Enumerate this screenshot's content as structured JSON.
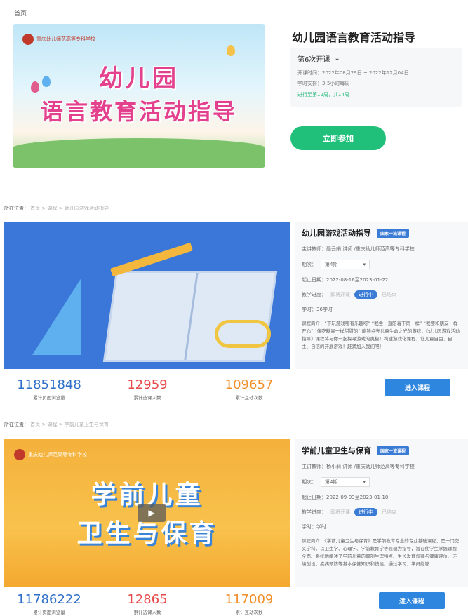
{
  "breadcrumb_top": "首页",
  "hero": {
    "banner_logo": "重庆幼儿师范高等专科学校",
    "banner_title_line1": "幼儿园",
    "banner_title_line2": "语言教育活动指导",
    "title": "幼儿园语言教育活动指导",
    "session": "第6次开课",
    "open_time": "开课时间：2022年08月29日 ~ 2022年12月04日",
    "study_plan": "学时安排：3-5小时每周",
    "progress": "进行至第12周，共14周",
    "join_label": "立即参加"
  },
  "cards": [
    {
      "breadcrumb_label": "所在位置：",
      "breadcrumb_path": "首页 > 课程 > 幼儿园游戏活动指导",
      "title": "幼儿园游戏活动指导",
      "tag": "国家一流课程",
      "teacher": "主讲教师：聂云娟 讲师 /重庆幼儿师范高等专科学校",
      "session_label": "期次：",
      "session_value": "第4期",
      "dates": "起止日期：2022-08-16至2023-01-22",
      "progress_label": "教学进度：",
      "progress_steps": [
        "即将开课",
        "进行中",
        "已结束"
      ],
      "hours": "学时：36学时",
      "description": "课程简介：“下玩游戏哪有乐趣呀” “我会一直陪着下雨一样” “我要和朋友一样开心” “像吃糖果一样甜甜的” 能够点亮儿童生命之光的游戏，《幼儿园游戏活动指导》课程将与你一起探寻游戏的奥秘！构建游戏化课程，让儿童自由、自主、自信的开展游戏！赶紧加入我们吧！",
      "stats": [
        {
          "value": "11851848",
          "label": "累计页面浏览量",
          "color": "#2e6fc7"
        },
        {
          "value": "12959",
          "label": "累计选课人数",
          "color": "#e84a4a"
        },
        {
          "value": "109657",
          "label": "累计互动次数",
          "color": "#f0902d"
        }
      ],
      "enter_label": "进入课程"
    },
    {
      "breadcrumb_label": "所在位置：",
      "breadcrumb_path": "首页 > 课程 > 学前儿童卫生与保育",
      "title": "学前儿童卫生与保育",
      "tag": "国家一流课程",
      "banner_logo": "重庆幼儿师范高等专科学校",
      "banner_line1": "学前儿童",
      "banner_line2": "卫生与保育",
      "teacher": "主讲教师：杨小莉 讲师 /重庆幼儿师范高等专科学校",
      "session_label": "期次：",
      "session_value": "第4期",
      "dates": "起止日期：2022-09-03至2023-01-10",
      "progress_label": "教学进度：",
      "progress_steps": [
        "即将开课",
        "进行中",
        "已结束"
      ],
      "hours": "学时：学时",
      "description": "课程简介：《学前儿童卫生与保育》是学前教育专业的专业基础课程，是一门交叉学科，以卫生学、心理学、学前教育学等原理为指导，旨在使学生掌握课程全面、系统地阐述了学前儿童的解剖生理特点、生长发育规律与健康评价、环境创设、疾病预防等基本保健知识和技能。通过学习，学员能够",
      "stats": [
        {
          "value": "11786222",
          "label": "累计页面浏览量",
          "color": "#2e6fc7"
        },
        {
          "value": "12865",
          "label": "累计选课人数",
          "color": "#e84a4a"
        },
        {
          "value": "117009",
          "label": "累计互动次数",
          "color": "#f0902d"
        }
      ],
      "enter_label": "进入课程"
    }
  ]
}
